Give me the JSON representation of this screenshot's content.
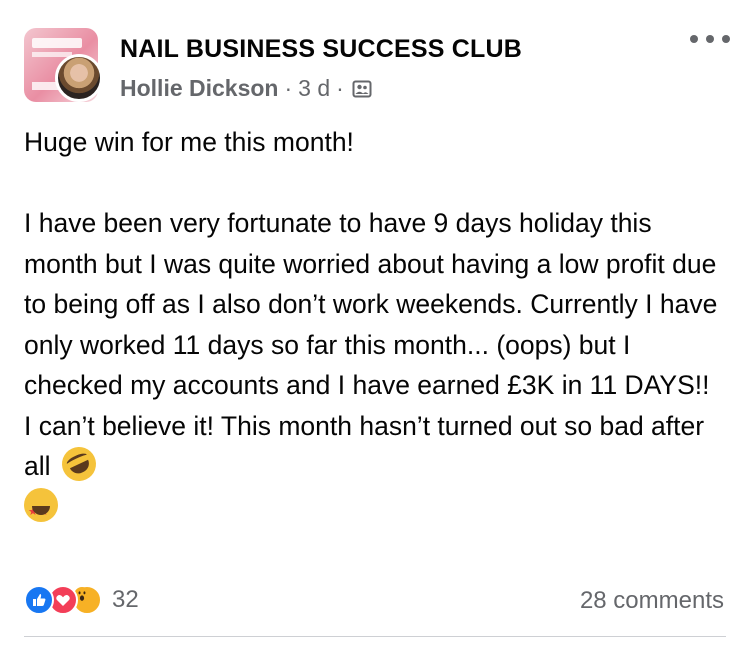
{
  "post": {
    "group_name": "NAIL BUSINESS SUCCESS CLUB",
    "author": "Hollie Dickson",
    "separator": "·",
    "time": "3 d",
    "privacy_icon": "group-privacy-icon",
    "more_icon": "more-options-icon",
    "text": "Huge win for me this month!\n\nI have been very fortunate to have 9 days holiday this month but I was quite worried about having a low profit due to being off as I also don’t work weekends. Currently I have only worked 11 days so far this month... (oops) but I checked my accounts and I have earned £3K in 11 DAYS!! I can’t believe it! This month hasn’t turned out so bad after all",
    "emojis": [
      "rolling-on-floor-laughing",
      "star-struck"
    ]
  },
  "footer": {
    "reactions": [
      "like",
      "love",
      "wow"
    ],
    "reaction_count": "32",
    "comments_label": "28 comments"
  },
  "colors": {
    "like": "#1877f2",
    "love": "#f33e58",
    "wow": "#f7b125",
    "secondary_text": "#65676b"
  }
}
